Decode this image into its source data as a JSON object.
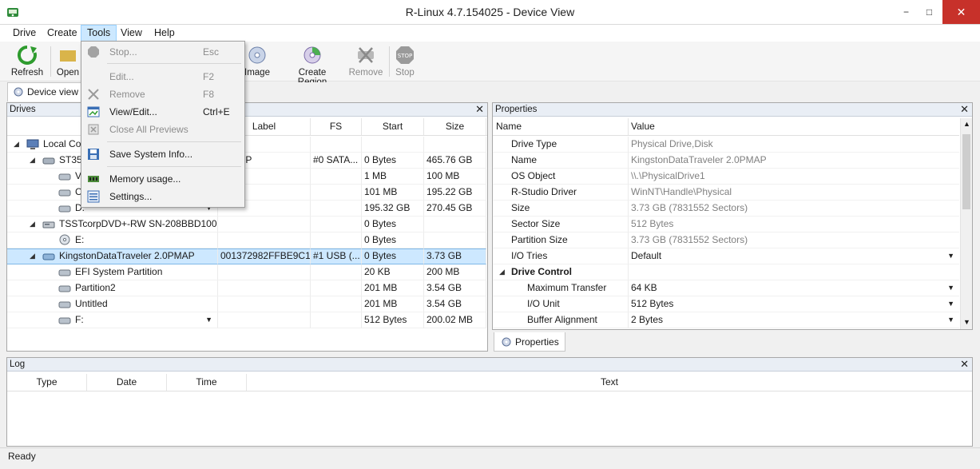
{
  "window": {
    "title": "R-Linux 4.7.154025 - Device View",
    "minimize": "−",
    "maximize": "□",
    "close": "✕"
  },
  "menu": [
    "Drive",
    "Create",
    "Tools",
    "View",
    "Help"
  ],
  "toolbar": {
    "refresh": "Refresh",
    "open": "Open",
    "create_image": "Image",
    "create_region": "Create Region",
    "remove": "Remove",
    "stop": "Stop"
  },
  "tools_menu": [
    {
      "label": "Stop...",
      "shortcut": "Esc",
      "disabled": true,
      "icon": "stop-icon"
    },
    {
      "label": "Edit...",
      "shortcut": "F2",
      "disabled": true,
      "icon": "edit-icon"
    },
    {
      "label": "Remove",
      "shortcut": "F8",
      "disabled": true,
      "icon": "remove-icon"
    },
    {
      "label": "View/Edit...",
      "shortcut": "Ctrl+E",
      "disabled": false,
      "icon": "view-edit-icon"
    },
    {
      "label": "Close All Previews",
      "shortcut": "",
      "disabled": true,
      "icon": "close-previews-icon"
    },
    {
      "label": "Save System Info...",
      "shortcut": "",
      "disabled": false,
      "icon": "save-info-icon"
    },
    {
      "label": "Memory usage...",
      "shortcut": "",
      "disabled": false,
      "icon": "memory-icon"
    },
    {
      "label": "Settings...",
      "shortcut": "",
      "disabled": false,
      "icon": "settings-icon"
    }
  ],
  "view_tab": "Device view",
  "drives": {
    "header": "Drives",
    "close": "✕",
    "columns": [
      "Label",
      "FS",
      "Start",
      "Size"
    ],
    "rows": [
      {
        "name": "Local Co",
        "label": "",
        "fs": "",
        "start": "",
        "size": ""
      },
      {
        "name": "ST350",
        "label": "AS8HP",
        "fs": "#0 SATA...",
        "start": "0 Bytes",
        "size": "465.76 GB"
      },
      {
        "name": "V",
        "label": "",
        "fs": "",
        "start": "1 MB",
        "size": "100 MB"
      },
      {
        "name": "C",
        "label": "",
        "fs": "",
        "start": "101 MB",
        "size": "195.22 GB"
      },
      {
        "name": "D:",
        "label": "",
        "fs": "",
        "start": "195.32 GB",
        "size": "270.45 GB"
      },
      {
        "name": "TSSTcorpDVD+-RW SN-208BBD100",
        "label": "",
        "fs": "",
        "start": "0 Bytes",
        "size": ""
      },
      {
        "name": "E:",
        "label": "",
        "fs": "",
        "start": "0 Bytes",
        "size": ""
      },
      {
        "name": "KingstonDataTraveler 2.0PMAP",
        "label": "001372982FFBE9C1...",
        "fs": "#1 USB (...",
        "start": "0 Bytes",
        "size": "3.73 GB"
      },
      {
        "name": "EFI System Partition",
        "label": "",
        "fs": "",
        "start": "20 KB",
        "size": "200 MB"
      },
      {
        "name": "Partition2",
        "label": "",
        "fs": "",
        "start": "201 MB",
        "size": "3.54 GB"
      },
      {
        "name": "Untitled",
        "label": "",
        "fs": "",
        "start": "201 MB",
        "size": "3.54 GB"
      },
      {
        "name": "F:",
        "label": "",
        "fs": "",
        "start": "512 Bytes",
        "size": "200.02 MB"
      }
    ]
  },
  "properties": {
    "header": "Properties",
    "close": "✕",
    "col_name": "Name",
    "col_value": "Value",
    "rows": [
      {
        "name": "Drive Type",
        "value": "Physical Drive,Disk"
      },
      {
        "name": "Name",
        "value": "KingstonDataTraveler 2.0PMAP"
      },
      {
        "name": "OS Object",
        "value": "\\\\.\\PhysicalDrive1"
      },
      {
        "name": "R-Studio Driver",
        "value": "WinNT\\Handle\\Physical"
      },
      {
        "name": "Size",
        "value": "3.73 GB (7831552 Sectors)"
      },
      {
        "name": "Sector Size",
        "value": "512 Bytes"
      },
      {
        "name": "Partition Size",
        "value": "3.73 GB (7831552 Sectors)"
      },
      {
        "name": "I/O Tries",
        "value": "Default"
      },
      {
        "name": "Drive Control",
        "value": ""
      },
      {
        "name": "Maximum Transfer",
        "value": "64 KB"
      },
      {
        "name": "I/O Unit",
        "value": "512 Bytes"
      },
      {
        "name": "Buffer Alignment",
        "value": "2 Bytes"
      }
    ],
    "tab": "Properties"
  },
  "log": {
    "header": "Log",
    "close": "✕",
    "columns": [
      "Type",
      "Date",
      "Time",
      "Text"
    ]
  },
  "status": "Ready",
  "colors": {
    "accent": "#cce8ff",
    "selection": "#cde8ff",
    "close": "#c7312a"
  }
}
